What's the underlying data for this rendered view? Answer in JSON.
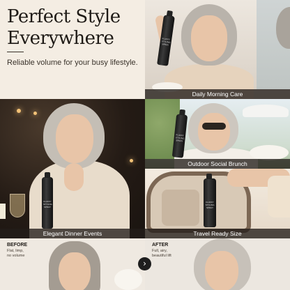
{
  "headline": {
    "title_line1": "Perfect Style",
    "title_line2": "Everywhere",
    "subtitle": "Reliable volume for your busy lifestyle."
  },
  "scenes": [
    {
      "caption": "Daily Morning Care"
    },
    {
      "caption": "Elegant Dinner Events"
    },
    {
      "caption": "Outdoor Social Brunch"
    },
    {
      "caption": "Travel Ready Size"
    }
  ],
  "product": {
    "label": "FLUFFY STYLING SPRAY"
  },
  "before": {
    "title": "BEFORE",
    "line1": "Flat, limp,",
    "line2": "no volume"
  },
  "after": {
    "title": "AFTER",
    "line1": "Full, airy,",
    "line2": "beautiful lift"
  },
  "colors": {
    "cream": "#f4ede3",
    "caption_bg": "#231e1a",
    "hair": "#b9b3ab"
  },
  "icons": {
    "arrow": "chevron-right-icon"
  }
}
